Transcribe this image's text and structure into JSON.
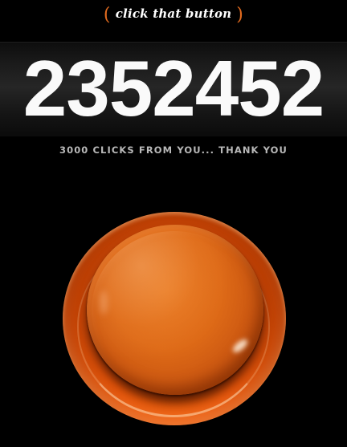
{
  "header": {
    "logo_text": "click that button",
    "paren_open": "(",
    "paren_close": ")",
    "accent_color": "#e06a1e"
  },
  "counter": {
    "total_clicks": "2352452"
  },
  "subtitle": {
    "text": "3000 CLICKS FROM YOU... THANK YOU"
  },
  "button": {
    "color": "#e8560a",
    "icon": "big-orange-push-button"
  }
}
